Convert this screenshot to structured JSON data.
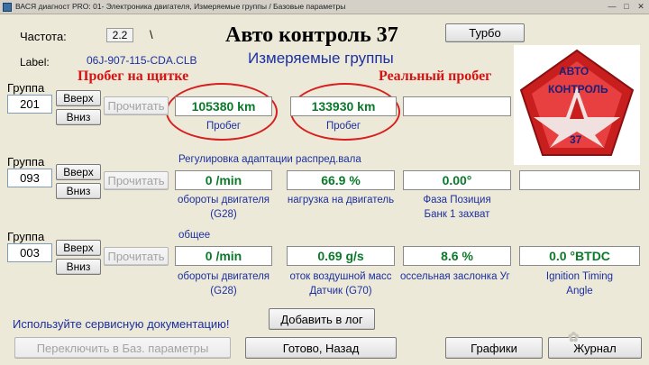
{
  "window": {
    "title": "ВАСЯ диагност PRO: 01- Электроника двигателя, Измеряемые группы / Базовые параметры"
  },
  "header": {
    "frequency_label": "Частота:",
    "frequency_value": "2.2",
    "frequency_suffix": "\\",
    "label_caption": "Label:",
    "label_value": "06J-907-115-CDA.CLB",
    "brand_title": "Авто контроль 37",
    "section_title": "Измеряемые группы",
    "turbo_button": "Турбо"
  },
  "annotations": {
    "odometer_dash": "Пробег на щитке",
    "odometer_real": "Реальный пробег"
  },
  "logo": {
    "line1": "АВТО",
    "line2": "КОНТРОЛЬ",
    "line3": "37"
  },
  "groups": [
    {
      "label": "Группа",
      "number": "201",
      "up": "Вверх",
      "down": "Вниз",
      "read": "Прочитать",
      "title": "",
      "values": [
        "105380 km",
        "133930 km",
        "",
        ""
      ],
      "captions": [
        "Пробег",
        "Пробег",
        "",
        ""
      ]
    },
    {
      "label": "Группа",
      "number": "093",
      "up": "Вверх",
      "down": "Вниз",
      "read": "Прочитать",
      "title": "Регулировка адаптации распред.вала",
      "values": [
        "0 /min",
        "66.9 %",
        "0.00°",
        ""
      ],
      "captions": [
        "обороты двигателя (G28)",
        "нагрузка на двигатель",
        "Фаза Позиция Банк 1 захват",
        ""
      ]
    },
    {
      "label": "Группа",
      "number": "003",
      "up": "Вверх",
      "down": "Вниз",
      "read": "Прочитать",
      "title": "общее",
      "values": [
        "0 /min",
        "0.69 g/s",
        "8.6 %",
        "0.0 °BTDC"
      ],
      "captions": [
        "обороты двигателя (G28)",
        "оток воздушной масс Датчик (G70)",
        "оссельная заслонка Уг",
        "Ignition Timing Angle"
      ]
    }
  ],
  "footer": {
    "service_doc": "Используйте сервисную документацию!",
    "add_log": "Добавить в лог",
    "switch_basic": "Переключить в Баз. параметры",
    "done_back": "Готово, Назад",
    "graphs": "Графики",
    "journal": "Журнал"
  },
  "colors": {
    "value_green": "#0a7a2a",
    "caption_blue": "#1c2fa0",
    "annotation_red": "#d41414"
  }
}
